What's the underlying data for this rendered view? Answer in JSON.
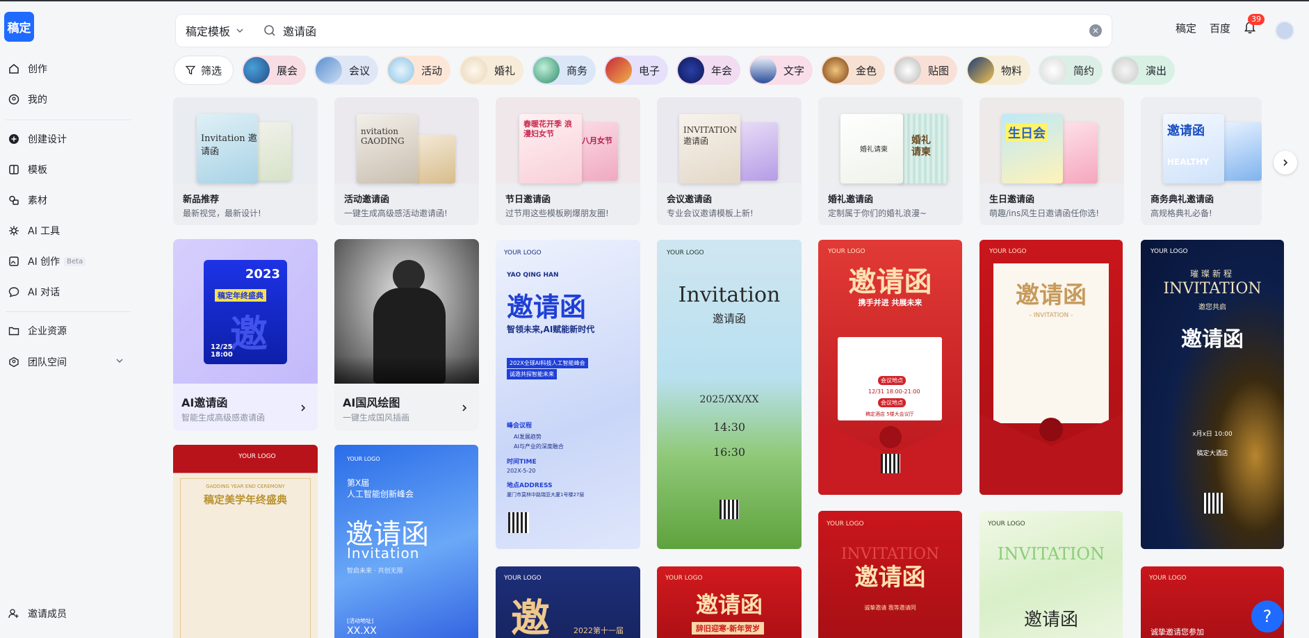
{
  "app": {
    "logo_text": "稿定"
  },
  "sidebar": {
    "items": [
      {
        "label": "创作"
      },
      {
        "label": "我的"
      },
      {
        "label": "创建设计"
      },
      {
        "label": "模板"
      },
      {
        "label": "素材"
      },
      {
        "label": "AI 工具"
      },
      {
        "label": "AI 创作",
        "badge": "Beta"
      },
      {
        "label": "AI 对话"
      },
      {
        "label": "企业资源"
      },
      {
        "label": "团队空间"
      }
    ],
    "invite_label": "邀请成员"
  },
  "header": {
    "scope": "稿定模板",
    "query": "邀请函",
    "links": [
      "稿定",
      "百度"
    ],
    "notif_count": "39"
  },
  "filter": {
    "label": "筛选"
  },
  "chips": [
    "展会",
    "会议",
    "活动",
    "婚礼",
    "商务",
    "电子",
    "年会",
    "文字",
    "金色",
    "贴图",
    "物料",
    "简约",
    "演出"
  ],
  "categories": [
    {
      "title": "新品推荐",
      "sub": "最新视觉，最新设计!",
      "p1": "Invitation 邀请函",
      "p2": "邀请函"
    },
    {
      "title": "活动邀请函",
      "sub": "一键生成高级感活动邀请函!",
      "p1": "nvitation GAODING",
      "p2": "邀请函"
    },
    {
      "title": "节日邀请函",
      "sub": "过节用这些模板刷爆朋友圈!",
      "p1": "春暖花开季 浪漫妇女节",
      "p2": "八月女节"
    },
    {
      "title": "会议邀请函",
      "sub": "专业会议邀请模板上新!",
      "p1": "INVITATION 邀请函",
      "p2": ""
    },
    {
      "title": "婚礼邀请函",
      "sub": "定制属于你们的婚礼浪漫~",
      "p1": "婚礼请柬",
      "p2": "婚礼请柬"
    },
    {
      "title": "生日邀请函",
      "sub": "萌趣/ins风生日邀请函任你选!",
      "p1": "生日会",
      "p2": ""
    },
    {
      "title": "商务典礼邀请函",
      "sub": "高规格典礼必备!",
      "p1": "邀请函",
      "p2": "HEALTHY"
    }
  ],
  "ai_cards": [
    {
      "title": "AI邀请函",
      "sub": "智能生成高级感邀请函",
      "year": "2023",
      "art_title": "稿定年终盛典",
      "date": "12/25 18:00"
    },
    {
      "title": "AI国风绘图",
      "sub": "一键生成国风插画"
    }
  ],
  "templates": {
    "t1": {
      "logo": "YOUR LOGO",
      "name": "YAO QING HAN",
      "title": "邀请函",
      "slogan": "智领未来,AI赋能新时代",
      "event": "202X全球AI科技人工智能峰会",
      "join": "诚邀共探智能未来",
      "agenda_h": "峰会议程",
      "agenda_1": "AI发展趋势",
      "agenda_2": "AI与产业的深度融合",
      "time_h": "时间TIME",
      "time": "202X-5-20",
      "addr_h": "地点ADDRESS",
      "addr": "厦门市莫林中路瑞亚大厦1号楼27层"
    },
    "t2": {
      "logo": "YOUR LOGO",
      "title": "Invitation",
      "sub": "邀请函",
      "date": "2025/XX/XX",
      "time1": "14:30",
      "time2": "16:30"
    },
    "t3": {
      "logo": "YOUR LOGO",
      "title": "邀请函",
      "slogan": "携手并进 共展未来",
      "tag1": "会议地点",
      "time": "12/31 18:00-21:00",
      "tag2": "会议地点",
      "place": "稿定酒店 5楼大会议厅"
    },
    "t4": {
      "logo": "YOUR LOGO",
      "title": "邀请函",
      "sub": "- INVITATION -"
    },
    "t5": {
      "logo": "YOUR LOGO",
      "top": "璀璨新程",
      "title": "INVITATION",
      "sub": "邀您共启",
      "big": "邀请函",
      "time": "x月x日 10:00",
      "place": "稿定大酒店"
    },
    "t6": {
      "logo": "YOUR LOGO",
      "sub": "GAODING YEAR END CEREMONY",
      "title": "稿定美学年终盛典"
    },
    "t7": {
      "logo": "YOUR LOGO",
      "small": "第X届",
      "small2": "人工智能创新峰会",
      "title": "邀请函",
      "en": "Invitation",
      "slogan": "智启未来 · 共创无限",
      "addr": "[活动地址]",
      "addr2": "XX.XX"
    },
    "t8": {
      "logo": "YOUR LOGO",
      "title": "邀",
      "sub": "2022第十一届"
    },
    "t9": {
      "logo": "YOUR LOGO",
      "title": "邀请函",
      "sub": "辞旧迎寒·新年贺岁"
    },
    "t10": {
      "logo": "YOUR LOGO",
      "en": "INVITATION",
      "title": "邀请函",
      "sub": "诚挚邀请 我等邀请同"
    },
    "t11": {
      "logo": "YOUR LOGO",
      "en": "INVITATION",
      "title": "邀请函"
    },
    "t12": {
      "logo": "YOUR LOGO",
      "title": "诚挚邀请您参加"
    }
  },
  "help_label": "?"
}
